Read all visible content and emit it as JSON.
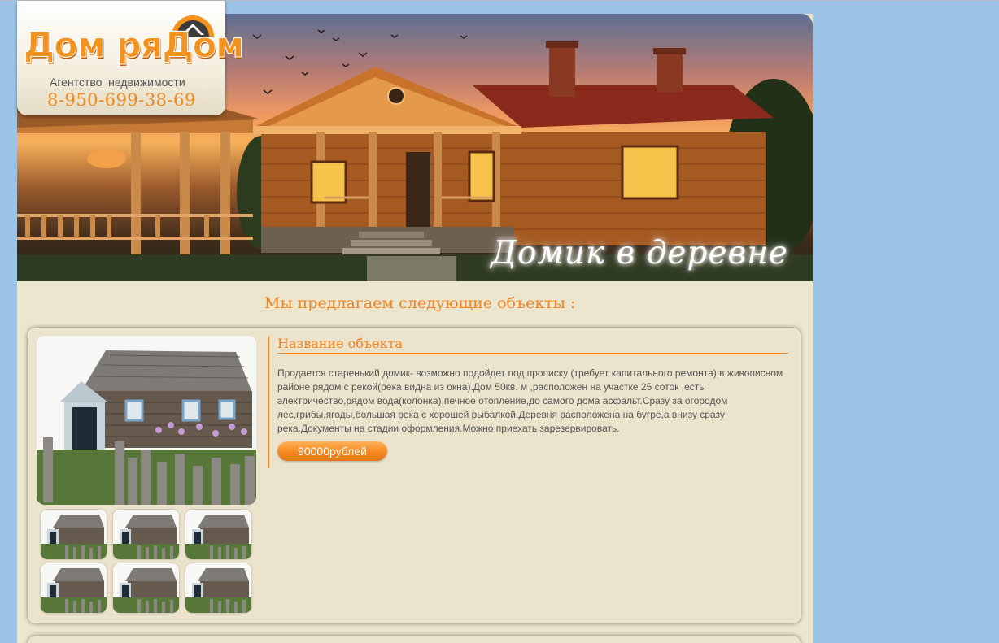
{
  "logo": {
    "name": "Дом ряДом",
    "subtitle": "Агентство  недвижимости",
    "phone": "8-950-699-38-69"
  },
  "banner": {
    "title": "Домик в деревне"
  },
  "offers": {
    "heading": "Мы предлагаем следующие объекты :",
    "items": [
      {
        "title": "Название объекта",
        "description": "Продается старенький домик-  возможно подойдет под прописку (требует капитального ремонта),в  живописном районе рядом с рекой(река видна из окна).Дом 50кв. м ,расположен на участке 25 соток ,есть электричество,рядом вода(колонка),печное отопление,до самого дома асфальт.Сразу за огородом лес,грибы,ягоды,большая река с хорошей рыбалкой.Деревня расположена на бугре,а внизу сразу река.Документы на стадии оформления.Можно приехать зарезервировать.",
        "price": "90000рублей",
        "photo_icon": "house-photo-icon",
        "thumbnail_count": 6
      }
    ]
  },
  "colors": {
    "background": "#9cc4e6",
    "page": "#ede6cf",
    "accent": "#ef8321",
    "text": "#555555"
  }
}
